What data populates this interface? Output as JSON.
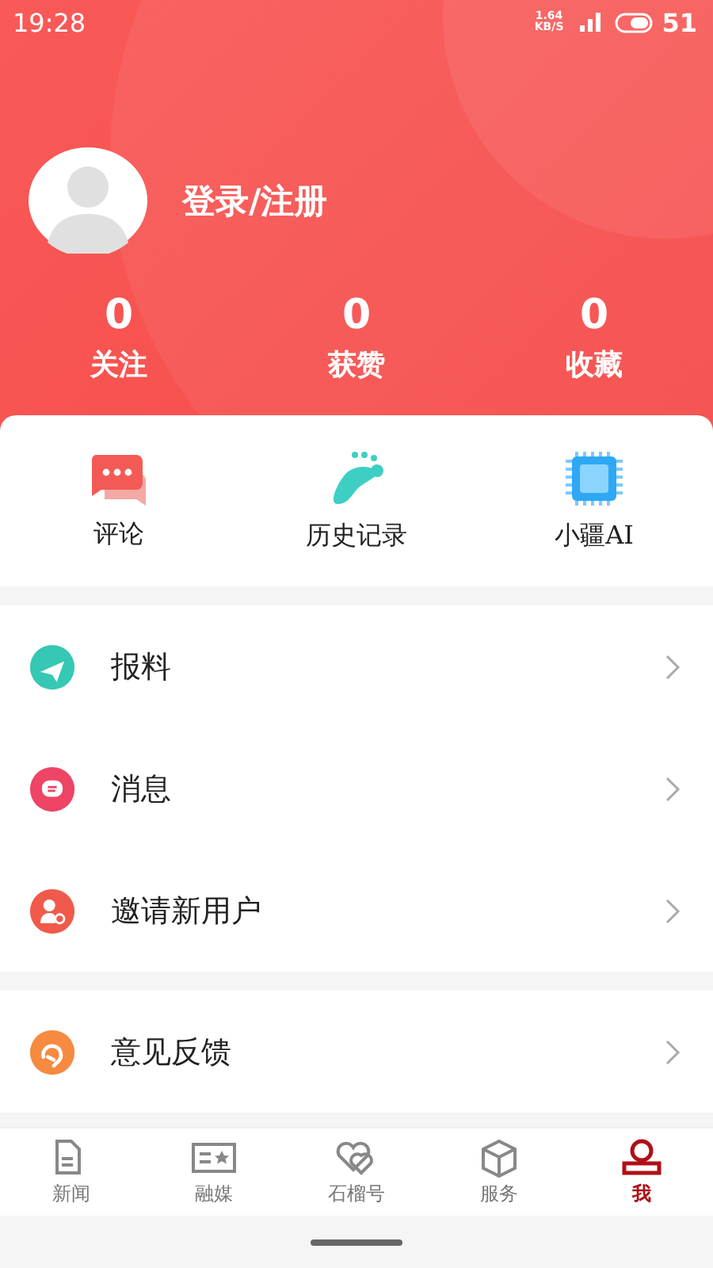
{
  "status_bar": {
    "time": "19:28",
    "speed": "1.64\nKB/S",
    "battery": "51"
  },
  "profile": {
    "login": "登录/注册"
  },
  "stats": [
    {
      "value": "0",
      "label": "关注"
    },
    {
      "value": "0",
      "label": "获赞"
    },
    {
      "value": "0",
      "label": "收藏"
    }
  ],
  "shortcuts": [
    {
      "kind": "comment",
      "label": "评论"
    },
    {
      "kind": "footprint",
      "label": "历史记录"
    },
    {
      "kind": "chip",
      "label": "小疆AI"
    }
  ],
  "menu_groups": [
    [
      {
        "kind": "plane",
        "label": "报料",
        "color": "#35c8b4"
      },
      {
        "kind": "message",
        "label": "消息",
        "color": "#ee4466"
      },
      {
        "kind": "invite",
        "label": "邀请新用户",
        "color": "#f05a4a"
      }
    ],
    [
      {
        "kind": "feedback",
        "label": "意见反馈",
        "color": "#f58a40"
      }
    ]
  ],
  "tab_bar": [
    {
      "kind": "news",
      "label": "新闻",
      "selected": false
    },
    {
      "kind": "media",
      "label": "融媒",
      "selected": false
    },
    {
      "kind": "hearts",
      "label": "石榴号",
      "selected": false
    },
    {
      "kind": "box",
      "label": "服务",
      "selected": false
    },
    {
      "kind": "person",
      "label": "我",
      "selected": true
    }
  ]
}
